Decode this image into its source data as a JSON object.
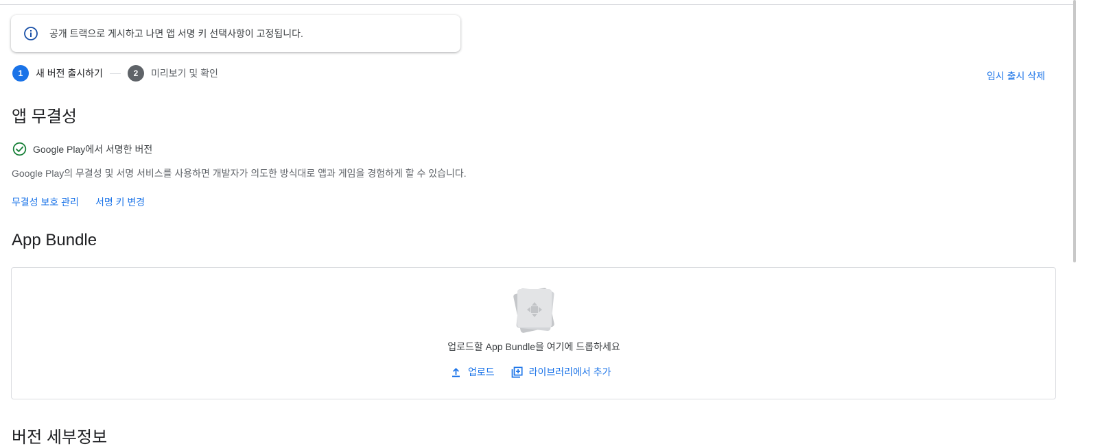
{
  "banner": {
    "icon": "info-icon",
    "text": "공개 트랙으로 게시하고 나면 앱 서명 키 선택사항이 고정됩니다."
  },
  "stepper": {
    "steps": [
      {
        "number": "1",
        "label": "새 버전 출시하기",
        "active": true
      },
      {
        "number": "2",
        "label": "미리보기 및 확인",
        "active": false
      }
    ]
  },
  "header_actions": {
    "delete_release": "임시 출시 삭제"
  },
  "integrity": {
    "title": "앱 무결성",
    "status_icon": "check-circle-icon",
    "status": "Google Play에서 서명한 버전",
    "description": "Google Play의 무결성 및 서명 서비스를 사용하면 개발자가 의도한 방식대로 앱과 게임을 경험하게 할 수 있습니다.",
    "links": {
      "manage": "무결성 보호 관리",
      "change_key": "서명 키 변경"
    }
  },
  "app_bundle": {
    "title": "App Bundle",
    "illustration_icon": "app-bundle-icon",
    "drop_text": "업로드할 App Bundle을 여기에 드롭하세요",
    "upload_icon": "upload-icon",
    "upload_label": "업로드",
    "library_icon": "library-add-icon",
    "library_label": "라이브러리에서 추가"
  },
  "next_section": {
    "title": "버전 세부정보"
  },
  "colors": {
    "accent": "#1a73e8",
    "success": "#188038",
    "step_inactive": "#5f6368",
    "border": "#dadce0"
  }
}
